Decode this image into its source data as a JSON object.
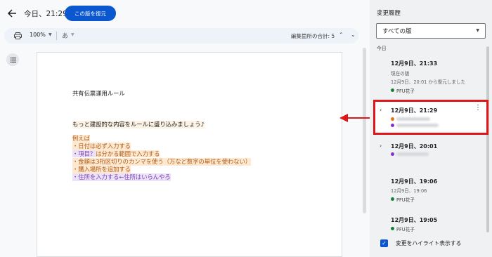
{
  "header": {
    "title": "今日、21:29",
    "restore_label": "この版を復元"
  },
  "toolbar": {
    "zoom": "100%",
    "input_tool": "あ",
    "edit_count": "編集箇所の合計: 5",
    "nav_up": "⌃",
    "nav_down": "⌄"
  },
  "document": {
    "heading": "共有伝票運用ルール",
    "intro": "もっと建設的な内容をルールに盛り込みましょう♪",
    "lines": [
      "例えば",
      "・日付は必ず入力する",
      "・項目？は分かる範囲で入力する",
      "・金額は3桁区切りのカンマを使う（万など数字の単位を使わない）",
      "・購入場所を追加する",
      "・住所を入力する←住所はいらんやろ"
    ]
  },
  "panel": {
    "title": "変更履歴",
    "filter": "すべての版",
    "section_today": "今日",
    "highlight_label": "変更をハイライト表示する",
    "entries": [
      {
        "time": "12月9日、21:33",
        "sub1": "現在の版",
        "sub2": "12月9日、20:01 から復元しました",
        "author": "PFU花子"
      },
      {
        "time": "12月9日、21:29"
      },
      {
        "time": "12月9日、20:01"
      },
      {
        "time": "12月9日、19:06",
        "sub1": "12月9日、19:06",
        "author": "PFU花子"
      },
      {
        "time": "12月9日、19:05",
        "author": "PFU花子"
      }
    ]
  },
  "colors": {
    "accent": "#0b57d0",
    "highlight_red": "#e0161b",
    "author_green": "#188038",
    "author_orange": "#e8710a",
    "author_purple": "#8430ce"
  }
}
